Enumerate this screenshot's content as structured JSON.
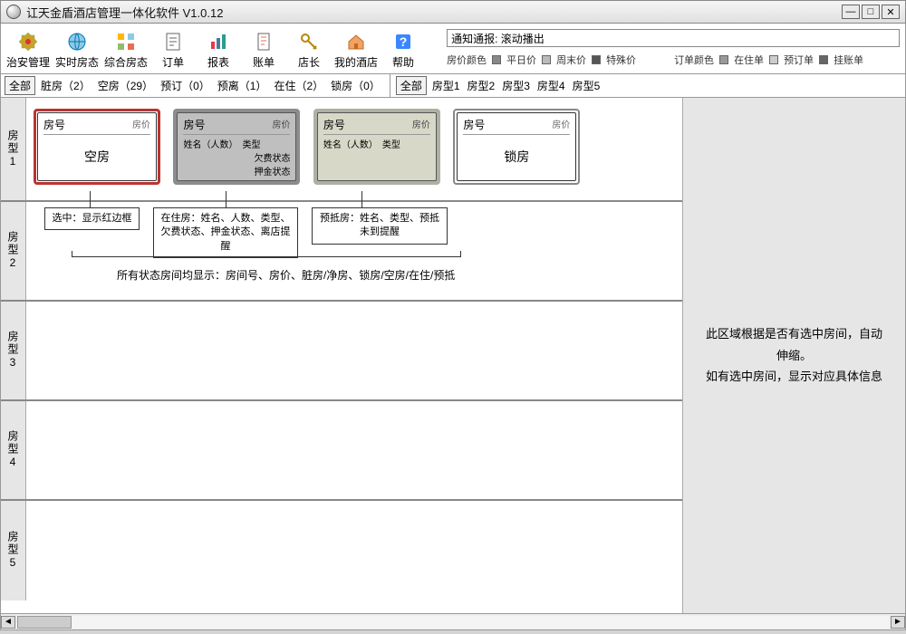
{
  "window": {
    "title": "讧天金盾酒店管理一体化软件  V1.0.12"
  },
  "toolbar": {
    "items": [
      {
        "label": "治安管理"
      },
      {
        "label": "实时房态"
      },
      {
        "label": "综合房态"
      },
      {
        "label": "订单"
      },
      {
        "label": "报表"
      },
      {
        "label": "账单"
      },
      {
        "label": "店长"
      },
      {
        "label": "我的酒店"
      },
      {
        "label": "帮助"
      }
    ]
  },
  "notice": {
    "label": "通知通报:",
    "text": "滚动播出"
  },
  "legend_price": {
    "label": "房价颜色",
    "items": [
      "平日价",
      "周末价",
      "特殊价"
    ]
  },
  "legend_order": {
    "label": "订单颜色",
    "items": [
      "在住单",
      "预订单",
      "挂账单"
    ]
  },
  "filter_left": {
    "all": "全部",
    "items": [
      "脏房（2）",
      "空房（29）",
      "预订（0）",
      "预离（1）",
      "在住（2）",
      "锁房（0）"
    ]
  },
  "filter_right": {
    "all": "全部",
    "items": [
      "房型1",
      "房型2",
      "房型3",
      "房型4",
      "房型5"
    ]
  },
  "row_labels": [
    "房型1",
    "房型2",
    "房型3",
    "房型4",
    "房型5"
  ],
  "cards": {
    "empty": {
      "room": "房号",
      "price": "房价",
      "status": "空房"
    },
    "occupied": {
      "room": "房号",
      "price": "房价",
      "line1": "姓名（人数）　类型",
      "line2": "欠费状态",
      "line3": "押金状态"
    },
    "prearrival": {
      "room": "房号",
      "price": "房价",
      "line1": "姓名（人数）　类型"
    },
    "locked": {
      "room": "房号",
      "price": "房价",
      "status": "锁房"
    }
  },
  "callouts": {
    "selected": "选中：显示红边框",
    "occupied": "在住房：姓名、人数、类型、欠费状态、押金状态、离店提醒",
    "prearrival": "预抵房：姓名、类型、预抵未到提醒",
    "summary": "所有状态房间均显示：房间号、房价、脏房/净房、锁房/空房/在住/预抵"
  },
  "rpanel": {
    "line1": "此区域根据是否有选中房间，自动伸缩。",
    "line2": "如有选中房间，显示对应具体信息"
  }
}
